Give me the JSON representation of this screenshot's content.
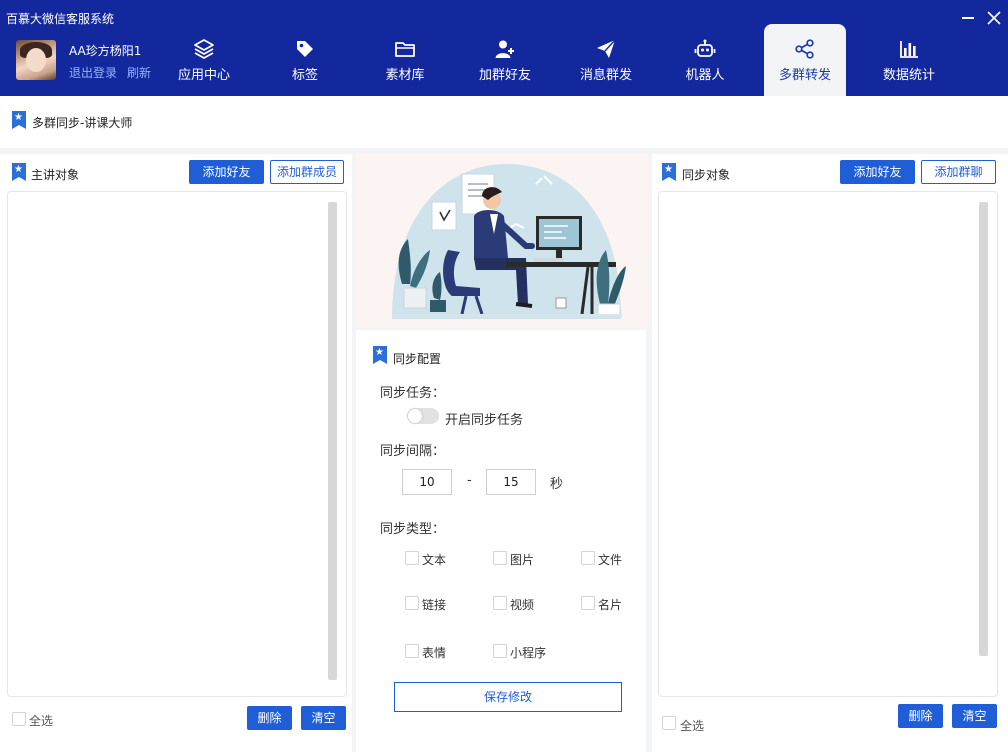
{
  "app": {
    "title": "百慕大微信客服系统"
  },
  "user": {
    "name": "AA珍方杨阳1",
    "logout_label": "退出登录",
    "refresh_label": "刷新"
  },
  "nav": {
    "tabs": [
      {
        "label": "应用中心",
        "icon": "layers-icon"
      },
      {
        "label": "标签",
        "icon": "tag-icon"
      },
      {
        "label": "素材库",
        "icon": "folder-icon"
      },
      {
        "label": "加群好友",
        "icon": "add-user-icon"
      },
      {
        "label": "消息群发",
        "icon": "send-icon"
      },
      {
        "label": "机器人",
        "icon": "robot-icon"
      },
      {
        "label": "多群转发",
        "icon": "share-icon",
        "active": true
      },
      {
        "label": "数据统计",
        "icon": "bar-chart-icon"
      }
    ]
  },
  "breadcrumb": {
    "title": "多群同步-讲课大师"
  },
  "left_panel": {
    "title": "主讲对象",
    "add_friend_label": "添加好友",
    "add_member_label": "添加群成员",
    "select_all_label": "全选",
    "delete_label": "删除",
    "clear_label": "清空"
  },
  "right_panel": {
    "title": "同步对象",
    "add_friend_label": "添加好友",
    "add_group_label": "添加群聊",
    "select_all_label": "全选",
    "delete_label": "删除",
    "clear_label": "清空"
  },
  "config": {
    "title": "同步配置",
    "task_label": "同步任务：",
    "task_toggle_label": "开启同步任务",
    "interval_label": "同步间隔：",
    "interval_min": "10",
    "interval_sep": "-",
    "interval_max": "15",
    "interval_unit": "秒",
    "type_label": "同步类型：",
    "types": [
      "文本",
      "图片",
      "文件",
      "链接",
      "视频",
      "名片",
      "表情",
      "小程序"
    ],
    "save_label": "保存修改"
  },
  "colors": {
    "header_bg": "#14289e",
    "primary": "#1f5ed6",
    "link": "#8fb3ff"
  }
}
